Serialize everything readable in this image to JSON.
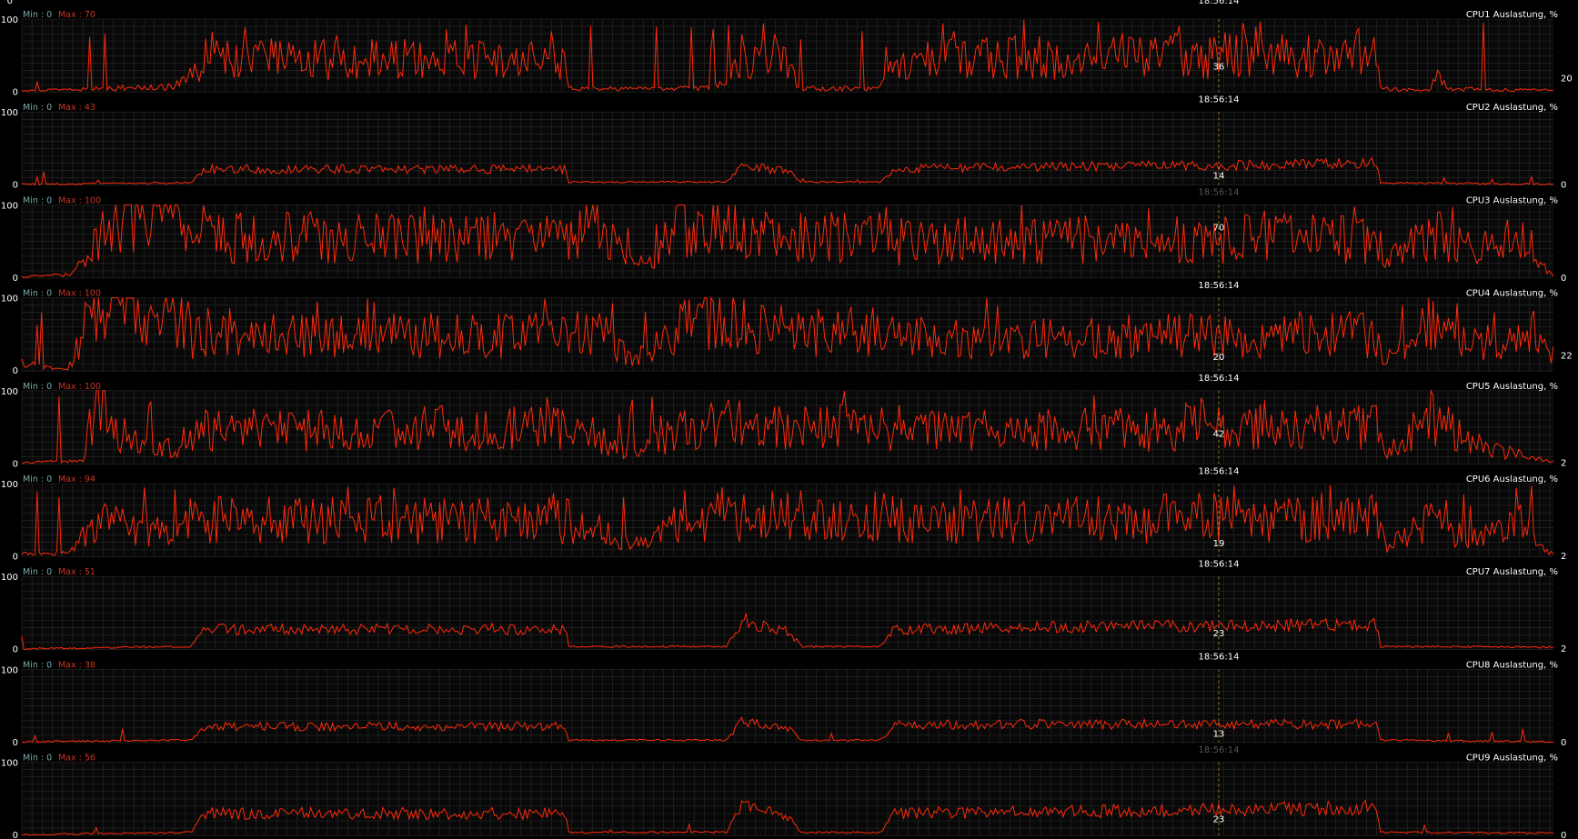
{
  "app": {
    "panel_count": 9,
    "top_edge_labels": {
      "zero_label": "0",
      "time_label": "18:56:14"
    }
  },
  "colors": {
    "background": "#000000",
    "plot_background": "#080808",
    "grid": "#2a2a2a",
    "trace": "#ff2a0a",
    "min_label": "#77aaaa",
    "max_label": "#cc3322",
    "text": "#ffffff",
    "cursor": "#cc9933"
  },
  "cursor": {
    "time": "18:56:14"
  },
  "panels": [
    {
      "title": "CPU1 Auslastung, %",
      "min_label": "Min : 0",
      "max_label": "Max : 70",
      "y_max": "100",
      "y_min": "0",
      "cursor_value": "36",
      "right_value": "20",
      "time_label": "18:56:14",
      "time_faint": false
    },
    {
      "title": "CPU2 Auslastung, %",
      "min_label": "Min : 0",
      "max_label": "Max : 43",
      "y_max": "100",
      "y_min": "0",
      "cursor_value": "14",
      "right_value": "0",
      "time_label": "18:56:14",
      "time_faint": true
    },
    {
      "title": "CPU3 Auslastung, %",
      "min_label": "Min : 0",
      "max_label": "Max : 100",
      "y_max": "100",
      "y_min": "0",
      "cursor_value": "70",
      "right_value": "0",
      "time_label": "18:56:14",
      "time_faint": false
    },
    {
      "title": "CPU4 Auslastung, %",
      "min_label": "Min : 0",
      "max_label": "Max : 100",
      "y_max": "100",
      "y_min": "0",
      "cursor_value": "20",
      "right_value": "22",
      "time_label": "18:56:14",
      "time_faint": false
    },
    {
      "title": "CPU5 Auslastung, %",
      "min_label": "Min : 0",
      "max_label": "Max : 100",
      "y_max": "100",
      "y_min": "0",
      "cursor_value": "42",
      "right_value": "2",
      "time_label": "18:56:14",
      "time_faint": false
    },
    {
      "title": "CPU6 Auslastung, %",
      "min_label": "Min : 0",
      "max_label": "Max : 94",
      "y_max": "100",
      "y_min": "0",
      "cursor_value": "19",
      "right_value": "2",
      "time_label": "18:56:14",
      "time_faint": false
    },
    {
      "title": "CPU7 Auslastung, %",
      "min_label": "Min : 0",
      "max_label": "Max : 51",
      "y_max": "100",
      "y_min": "0",
      "cursor_value": "23",
      "right_value": "2",
      "time_label": "18:56:14",
      "time_faint": false
    },
    {
      "title": "CPU8 Auslastung, %",
      "min_label": "Min : 0",
      "max_label": "Max : 38",
      "y_max": "100",
      "y_min": "0",
      "cursor_value": "13",
      "right_value": "0",
      "time_label": "18:56:14",
      "time_faint": true
    },
    {
      "title": "CPU9 Auslastung, %",
      "min_label": "Min : 0",
      "max_label": "Max : 56",
      "y_max": "100",
      "y_min": "0",
      "cursor_value": "23",
      "right_value": "0",
      "time_label": "18:56:14",
      "time_faint": false
    }
  ],
  "chart_data": [
    {
      "type": "line",
      "title": "CPU1 Auslastung, %",
      "ylim": [
        0,
        100
      ],
      "x": [
        0,
        0.03,
        0.05,
        0.1,
        0.11,
        0.12,
        0.3,
        0.355,
        0.357,
        0.44,
        0.46,
        0.47,
        0.5,
        0.51,
        0.56,
        0.57,
        0.77,
        0.885,
        0.887,
        0.92,
        0.925,
        0.93,
        1
      ],
      "values": [
        0,
        3,
        5,
        8,
        20,
        45,
        45,
        40,
        5,
        5,
        10,
        55,
        40,
        5,
        5,
        45,
        50,
        52,
        5,
        3,
        35,
        5,
        2
      ]
    },
    {
      "type": "line",
      "title": "CPU2 Auslastung, %",
      "ylim": [
        0,
        100
      ],
      "x": [
        0,
        0.11,
        0.12,
        0.355,
        0.357,
        0.46,
        0.47,
        0.5,
        0.51,
        0.56,
        0.57,
        0.885,
        0.887,
        1
      ],
      "values": [
        0,
        2,
        22,
        22,
        3,
        3,
        25,
        20,
        3,
        3,
        22,
        30,
        2,
        0
      ]
    },
    {
      "type": "line",
      "title": "CPU3 Auslastung, %",
      "ylim": [
        0,
        100
      ],
      "x": [
        0,
        0.03,
        0.05,
        0.06,
        0.1,
        0.11,
        0.36,
        0.37,
        0.4,
        0.43,
        0.46,
        0.47,
        0.56,
        0.57,
        0.885,
        0.89,
        0.92,
        0.95,
        0.98,
        1
      ],
      "values": [
        0,
        5,
        60,
        100,
        90,
        55,
        55,
        85,
        15,
        65,
        80,
        55,
        55,
        50,
        55,
        20,
        60,
        40,
        60,
        0
      ]
    },
    {
      "type": "line",
      "title": "CPU4 Auslastung, %",
      "ylim": [
        0,
        100
      ],
      "x": [
        0,
        0.03,
        0.045,
        0.06,
        0.1,
        0.11,
        0.36,
        0.37,
        0.4,
        0.43,
        0.46,
        0.47,
        0.56,
        0.57,
        0.885,
        0.89,
        0.92,
        0.95,
        0.98,
        1
      ],
      "values": [
        10,
        0,
        80,
        100,
        90,
        45,
        50,
        60,
        15,
        70,
        80,
        55,
        55,
        45,
        50,
        15,
        70,
        35,
        55,
        22
      ]
    },
    {
      "type": "line",
      "title": "CPU5 Auslastung, %",
      "ylim": [
        0,
        100
      ],
      "x": [
        0,
        0.04,
        0.05,
        0.06,
        0.1,
        0.11,
        0.36,
        0.37,
        0.4,
        0.43,
        0.46,
        0.47,
        0.56,
        0.57,
        0.885,
        0.89,
        0.92,
        0.95,
        1
      ],
      "values": [
        0,
        5,
        100,
        45,
        20,
        45,
        50,
        40,
        15,
        45,
        55,
        50,
        55,
        45,
        50,
        10,
        70,
        25,
        2
      ]
    },
    {
      "type": "line",
      "title": "CPU6 Auslastung, %",
      "ylim": [
        0,
        100
      ],
      "x": [
        0,
        0.03,
        0.045,
        0.06,
        0.1,
        0.11,
        0.36,
        0.37,
        0.4,
        0.43,
        0.46,
        0.47,
        0.56,
        0.57,
        0.885,
        0.89,
        0.92,
        0.95,
        0.98,
        1
      ],
      "values": [
        5,
        5,
        35,
        45,
        30,
        50,
        50,
        45,
        15,
        55,
        60,
        55,
        55,
        50,
        55,
        15,
        50,
        25,
        45,
        2
      ]
    },
    {
      "type": "line",
      "title": "CPU7 Auslastung, %",
      "ylim": [
        0,
        100
      ],
      "x": [
        0,
        0.11,
        0.12,
        0.355,
        0.357,
        0.46,
        0.47,
        0.5,
        0.51,
        0.56,
        0.57,
        0.885,
        0.887,
        1
      ],
      "values": [
        0,
        3,
        28,
        28,
        3,
        3,
        40,
        25,
        3,
        3,
        28,
        35,
        3,
        2
      ]
    },
    {
      "type": "line",
      "title": "CPU8 Auslastung, %",
      "ylim": [
        0,
        100
      ],
      "x": [
        0,
        0.11,
        0.12,
        0.355,
        0.357,
        0.46,
        0.47,
        0.5,
        0.51,
        0.56,
        0.57,
        0.885,
        0.887,
        1
      ],
      "values": [
        0,
        2,
        22,
        22,
        2,
        2,
        28,
        20,
        2,
        2,
        25,
        25,
        2,
        0
      ]
    },
    {
      "type": "line",
      "title": "CPU9 Auslastung, %",
      "ylim": [
        0,
        100
      ],
      "x": [
        0,
        0.11,
        0.12,
        0.355,
        0.357,
        0.46,
        0.47,
        0.5,
        0.51,
        0.56,
        0.57,
        0.885,
        0.887,
        1
      ],
      "values": [
        0,
        3,
        30,
        30,
        3,
        3,
        40,
        25,
        3,
        3,
        30,
        38,
        3,
        2
      ]
    }
  ]
}
